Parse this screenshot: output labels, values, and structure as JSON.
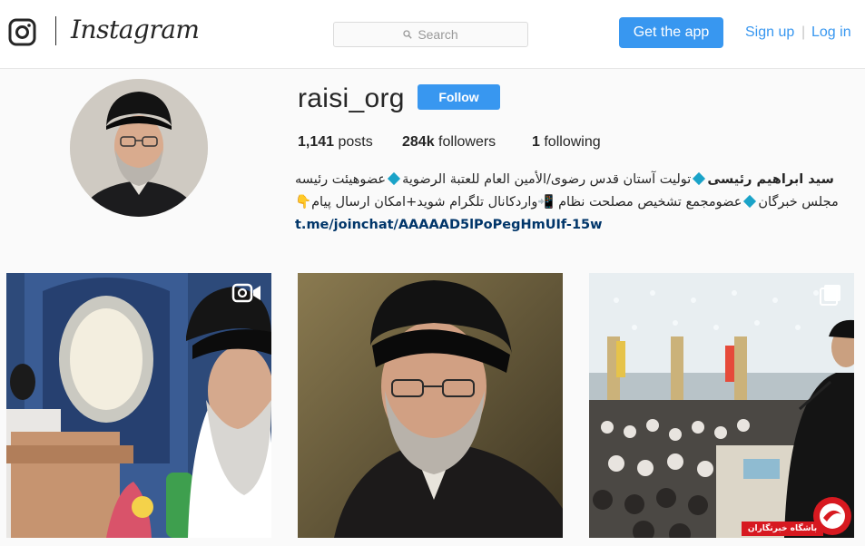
{
  "header": {
    "wordmark": "Instagram",
    "search_placeholder": "Search",
    "get_app_label": "Get the app",
    "signup_label": "Sign up",
    "separator": "|",
    "login_label": "Log in"
  },
  "profile": {
    "username": "raisi_org",
    "follow_label": "Follow",
    "stats": {
      "posts_count": "1,141",
      "posts_label": "posts",
      "followers_count": "284k",
      "followers_label": "followers",
      "following_count": "1",
      "following_label": "following"
    },
    "bio": {
      "name": "سید ابراهیم رئیسی",
      "segment1": "تولیت آستان قدس رضوی/الأمين العام للعتبة الرضوية",
      "segment2": "عضوهیئت رئیسه مجلس خبرگان",
      "segment3": "عضومجمع تشخیص مصلحت نظام",
      "segment4": "واردکانال تلگرام شوید+امکان ارسال پیام",
      "link": "t.me/joinchat/AAAAAD5lPoPegHmUIf-15w"
    }
  },
  "posts": [
    {
      "type": "video",
      "icon": "video-camera-icon"
    },
    {
      "type": "photo"
    },
    {
      "type": "carousel",
      "icon": "multiple-photos-icon"
    }
  ],
  "watermark": {
    "text": "باشگاه خبرنگاران"
  },
  "colors": {
    "accent": "#3897f0",
    "link": "#003569",
    "watermark_red": "#d71920"
  }
}
